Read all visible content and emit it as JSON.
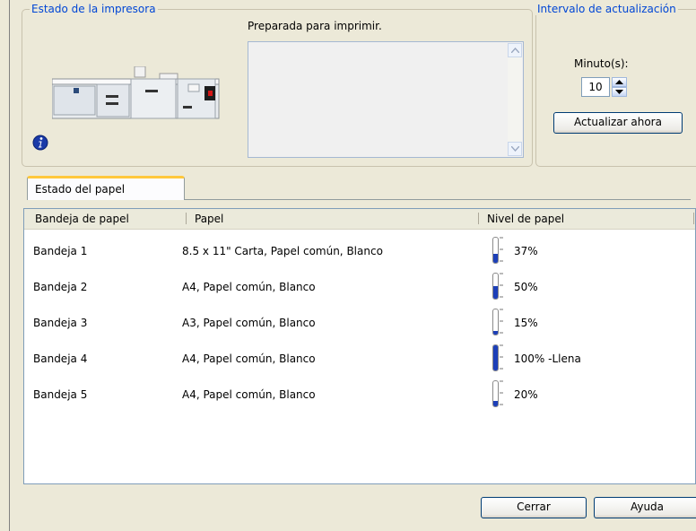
{
  "printer_status": {
    "legend": "Estado de la impresora",
    "message": "Preparada para imprimir.",
    "info_icon": "info-icon",
    "printer_image": "production-printer-image"
  },
  "refresh_interval": {
    "legend": "Intervalo de actualización",
    "minutes_label": "Minuto(s):",
    "minutes_value": "10",
    "refresh_button": "Actualizar ahora"
  },
  "tabs": [
    {
      "label": "Estado del papel",
      "selected": true
    }
  ],
  "paper_table": {
    "columns": [
      "Bandeja de papel",
      "Papel",
      "Nivel de papel"
    ],
    "rows": [
      {
        "tray": "Bandeja 1",
        "paper": "8.5 x 11\" Carta, Papel común, Blanco",
        "level_text": "37%",
        "level": 0.37
      },
      {
        "tray": "Bandeja 2",
        "paper": "A4, Papel común, Blanco",
        "level_text": "50%",
        "level": 0.5
      },
      {
        "tray": "Bandeja 3",
        "paper": "A3, Papel común, Blanco",
        "level_text": "15%",
        "level": 0.15
      },
      {
        "tray": "Bandeja 4",
        "paper": "A4, Papel común, Blanco",
        "level_text": "100% -Llena",
        "level": 1.0
      },
      {
        "tray": "Bandeja 5",
        "paper": "A4, Papel común, Blanco",
        "level_text": "20%",
        "level": 0.2
      }
    ]
  },
  "buttons": {
    "close": "Cerrar",
    "help": "Ayuda"
  },
  "colors": {
    "legend_text": "#0046d5",
    "gauge_fill": "#1c3fb8",
    "tab_highlight": "#ffc83c",
    "dialog_bg": "#ece9d8"
  }
}
